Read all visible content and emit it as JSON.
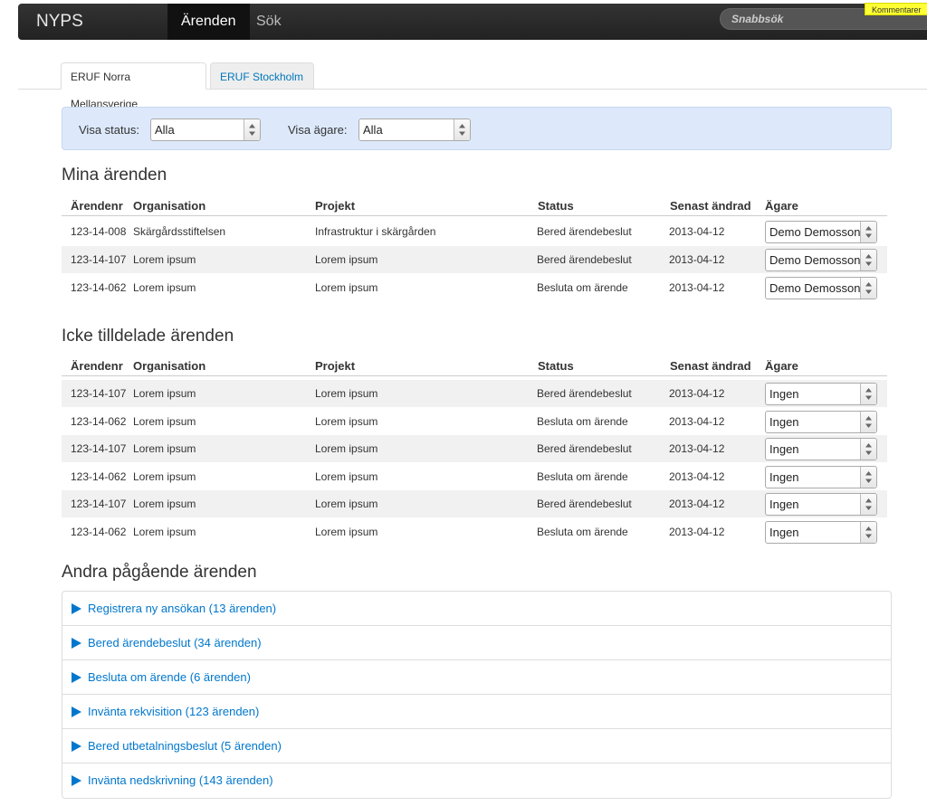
{
  "nav": {
    "brand": "NYPS",
    "items": [
      {
        "label": "Ärenden",
        "active": true
      },
      {
        "label": "Sök",
        "active": false
      }
    ],
    "search_placeholder": "Snabbsök",
    "comment_label": "Kommentarer"
  },
  "tabs": [
    {
      "label": "ERUF Norra Mellansverige",
      "active": true
    },
    {
      "label": "ERUF Stockholm",
      "active": false
    }
  ],
  "filters": {
    "status_label": "Visa status:",
    "status_value": "Alla",
    "owner_label": "Visa ägare:",
    "owner_value": "Alla"
  },
  "columns": [
    "Ärendenr",
    "Organisation",
    "Projekt",
    "Status",
    "Senast ändrad",
    "Ägare"
  ],
  "mine": {
    "title": "Mina ärenden",
    "rows": [
      {
        "nr": "123-14-008",
        "org": "Skärgårdsstiftelsen",
        "project": "Infrastruktur i skärgården",
        "status": "Bered ärendebeslut",
        "changed": "2013-04-12",
        "owner": "Demo Demosson"
      },
      {
        "nr": "123-14-107",
        "org": "Lorem ipsum",
        "project": "Lorem ipsum",
        "status": "Bered ärendebeslut",
        "changed": "2013-04-12",
        "owner": "Demo Demosson"
      },
      {
        "nr": "123-14-062",
        "org": "Lorem ipsum",
        "project": "Lorem ipsum",
        "status": "Besluta om ärende",
        "changed": "2013-04-12",
        "owner": "Demo Demosson"
      }
    ]
  },
  "unassigned": {
    "title": "Icke tilldelade ärenden",
    "rows": [
      {
        "nr": "123-14-107",
        "org": "Lorem ipsum",
        "project": "Lorem ipsum",
        "status": "Bered ärendebeslut",
        "changed": "2013-04-12",
        "owner": "Ingen"
      },
      {
        "nr": "123-14-062",
        "org": "Lorem ipsum",
        "project": "Lorem ipsum",
        "status": "Besluta om ärende",
        "changed": "2013-04-12",
        "owner": "Ingen"
      },
      {
        "nr": "123-14-107",
        "org": "Lorem ipsum",
        "project": "Lorem ipsum",
        "status": "Bered ärendebeslut",
        "changed": "2013-04-12",
        "owner": "Ingen"
      },
      {
        "nr": "123-14-062",
        "org": "Lorem ipsum",
        "project": "Lorem ipsum",
        "status": "Besluta om ärende",
        "changed": "2013-04-12",
        "owner": "Ingen"
      },
      {
        "nr": "123-14-107",
        "org": "Lorem ipsum",
        "project": "Lorem ipsum",
        "status": "Bered ärendebeslut",
        "changed": "2013-04-12",
        "owner": "Ingen"
      },
      {
        "nr": "123-14-062",
        "org": "Lorem ipsum",
        "project": "Lorem ipsum",
        "status": "Besluta om ärende",
        "changed": "2013-04-12",
        "owner": "Ingen"
      }
    ]
  },
  "other": {
    "title": "Andra pågående ärenden",
    "items": [
      "Registrera ny ansökan (13 ärenden)",
      "Bered ärendebeslut (34 ärenden)",
      "Besluta om ärende (6 ärenden)",
      "Invänta rekvisition (123 ärenden)",
      "Bered utbetalningsbeslut (5 ärenden)",
      "Invänta nedskrivning (143 ärenden)"
    ]
  },
  "colors": {
    "accent": "#0077cc",
    "navbar": "#222222",
    "filter_bg": "#dde9fb",
    "stripe": "#f1f1f1"
  }
}
